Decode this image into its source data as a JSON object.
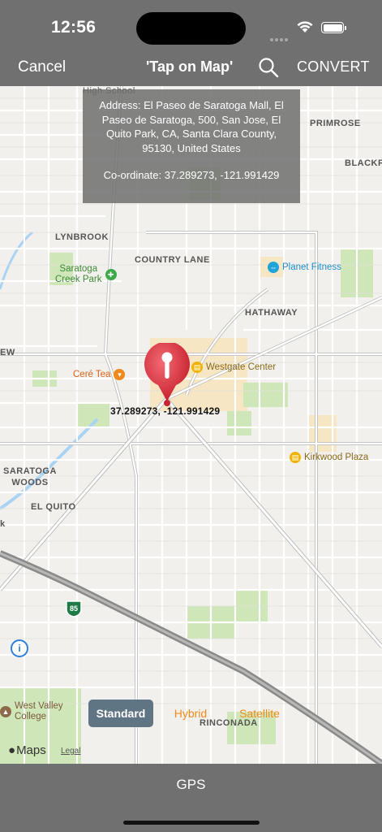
{
  "status": {
    "time": "12:56"
  },
  "nav": {
    "cancel": "Cancel",
    "title": "'Tap on Map'",
    "convert": "CONVERT"
  },
  "info": {
    "address_line1": "Address: El Paseo de Saratoga Mall, El",
    "address_line2": "Paseo de Saratoga, 500, San Jose, El",
    "address_line3": "Quito Park, CA, Santa Clara County,",
    "address_line4": "95130, United States",
    "coordinate": "Co-ordinate: 37.289273, -121.991429"
  },
  "pin": {
    "label": "37.289273, -121.991429"
  },
  "map": {
    "labels": {
      "high_school": "High School",
      "primrose": "PRIMROSE",
      "blackford": "BLACKFOI",
      "lynbrook": "LYNBROOK",
      "country_lane": "COUNTRY LANE",
      "hathaway": "HATHAWAY",
      "saratoga_woods_1": "SARATOGA",
      "saratoga_woods_2": "WOODS",
      "el_quito": "EL QUITO",
      "rinconada": "RINCONADA",
      "ew": "EW",
      "k": "k",
      "highway": "85"
    },
    "pois": {
      "planet_fitness": "Planet Fitness",
      "westgate": "Westgate Center",
      "cere_tea": "Ceré Tea",
      "kirkwood": "Kirkwood Plaza",
      "creek_park_1": "Saratoga",
      "creek_park_2": "Creek Park",
      "west_valley_1": "West Valley",
      "west_valley_2": "College"
    },
    "types": {
      "standard": "Standard",
      "hybrid": "Hybrid",
      "satellite": "Satellite"
    },
    "selected_type": "Standard",
    "attribution": {
      "maps": "Maps",
      "legal": "Legal"
    },
    "colors": {
      "park": "#cfe6b8",
      "commercial": "#f6e6c4",
      "water": "#a9d3f5",
      "highway": "#8a8a8a"
    }
  },
  "bottom": {
    "gps": "GPS"
  }
}
